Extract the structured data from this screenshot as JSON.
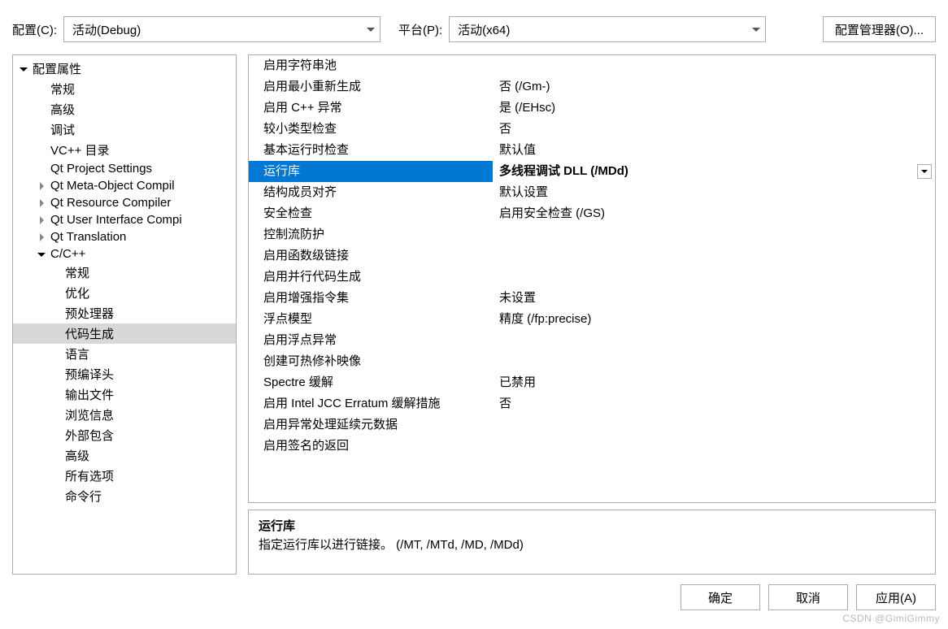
{
  "top": {
    "config_label": "配置(C):",
    "config_value": "活动(Debug)",
    "platform_label": "平台(P):",
    "platform_value": "活动(x64)",
    "config_manager": "配置管理器(O)..."
  },
  "tree": {
    "root": "配置属性",
    "items": [
      {
        "label": "常规",
        "level": 1
      },
      {
        "label": "高级",
        "level": 1
      },
      {
        "label": "调试",
        "level": 1
      },
      {
        "label": "VC++ 目录",
        "level": 1
      },
      {
        "label": "Qt Project Settings",
        "level": 1
      },
      {
        "label": "Qt Meta-Object Compil",
        "level": 1,
        "expandable": true
      },
      {
        "label": "Qt Resource Compiler",
        "level": 1,
        "expandable": true
      },
      {
        "label": "Qt User Interface Compi",
        "level": 1,
        "expandable": true
      },
      {
        "label": "Qt Translation",
        "level": 1,
        "expandable": true
      },
      {
        "label": "C/C++",
        "level": 1,
        "expandable": true,
        "open": true,
        "children": [
          {
            "label": "常规",
            "level": 2
          },
          {
            "label": "优化",
            "level": 2
          },
          {
            "label": "预处理器",
            "level": 2
          },
          {
            "label": "代码生成",
            "level": 2,
            "selected": true
          },
          {
            "label": "语言",
            "level": 2
          },
          {
            "label": "预编译头",
            "level": 2
          },
          {
            "label": "输出文件",
            "level": 2
          },
          {
            "label": "浏览信息",
            "level": 2
          },
          {
            "label": "外部包含",
            "level": 2
          },
          {
            "label": "高级",
            "level": 2
          },
          {
            "label": "所有选项",
            "level": 2
          },
          {
            "label": "命令行",
            "level": 2
          }
        ]
      }
    ]
  },
  "props": [
    {
      "key": "启用字符串池",
      "val": ""
    },
    {
      "key": "启用最小重新生成",
      "val": "否 (/Gm-)"
    },
    {
      "key": "启用 C++ 异常",
      "val": "是 (/EHsc)"
    },
    {
      "key": "较小类型检查",
      "val": "否"
    },
    {
      "key": "基本运行时检查",
      "val": "默认值"
    },
    {
      "key": "运行库",
      "val": "多线程调试 DLL (/MDd)",
      "selected": true
    },
    {
      "key": "结构成员对齐",
      "val": "默认设置"
    },
    {
      "key": "安全检查",
      "val": "启用安全检查 (/GS)"
    },
    {
      "key": "控制流防护",
      "val": ""
    },
    {
      "key": "启用函数级链接",
      "val": ""
    },
    {
      "key": "启用并行代码生成",
      "val": ""
    },
    {
      "key": "启用增强指令集",
      "val": "未设置"
    },
    {
      "key": "浮点模型",
      "val": "精度 (/fp:precise)"
    },
    {
      "key": "启用浮点异常",
      "val": ""
    },
    {
      "key": "创建可热修补映像",
      "val": ""
    },
    {
      "key": "Spectre 缓解",
      "val": "已禁用"
    },
    {
      "key": "启用 Intel JCC Erratum 缓解措施",
      "val": "否"
    },
    {
      "key": "启用异常处理延续元数据",
      "val": ""
    },
    {
      "key": "启用签名的返回",
      "val": ""
    }
  ],
  "desc": {
    "title": "运行库",
    "body": "指定运行库以进行链接。     (/MT, /MTd, /MD, /MDd)"
  },
  "buttons": {
    "ok": "确定",
    "cancel": "取消",
    "apply": "应用(A)"
  },
  "watermark": "CSDN @GimiGimmy"
}
